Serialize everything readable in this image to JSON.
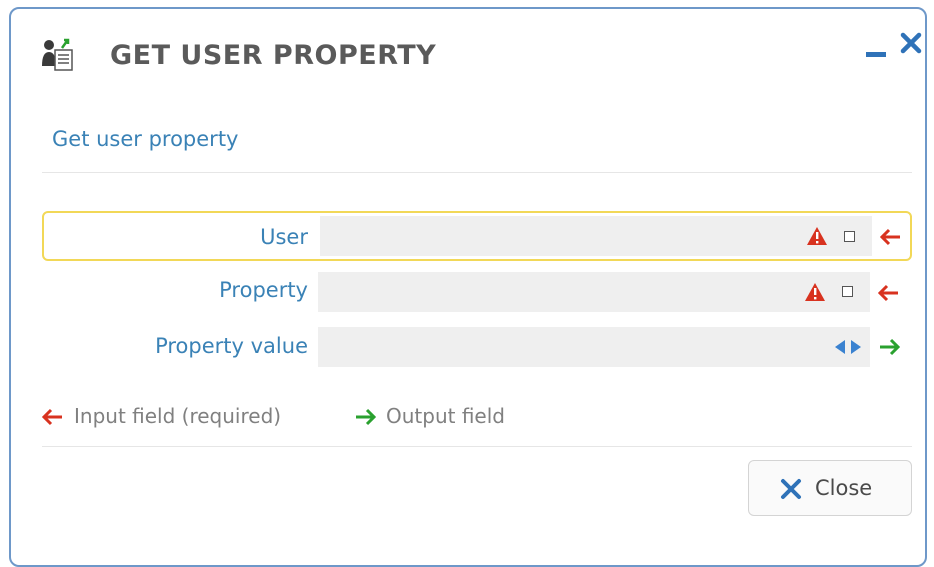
{
  "dialog": {
    "title": "GET USER PROPERTY",
    "subtitle": "Get user property"
  },
  "fields": [
    {
      "label": "User",
      "required": true,
      "direction": "input"
    },
    {
      "label": "Property",
      "required": true,
      "direction": "input"
    },
    {
      "label": "Property value",
      "required": false,
      "direction": "output"
    }
  ],
  "legend": {
    "input_label": "Input field (required)",
    "output_label": "Output field"
  },
  "buttons": {
    "close_label": "Close"
  },
  "colors": {
    "accent_blue": "#3a82b6",
    "frame_blue": "#6e98c9",
    "input_arrow_red": "#d8321f",
    "output_arrow_green": "#2aa12f",
    "warning_red": "#d8321f",
    "active_border_yellow": "#f2d857",
    "field_bg": "#efefef"
  },
  "icons": {
    "title": "user-document-icon",
    "minimize": "minimize-icon",
    "close": "close-icon",
    "warning": "warning-icon",
    "input_arrow": "arrow-left-icon",
    "output_arrow": "arrow-right-icon",
    "expand": "left-right-arrows-icon"
  }
}
